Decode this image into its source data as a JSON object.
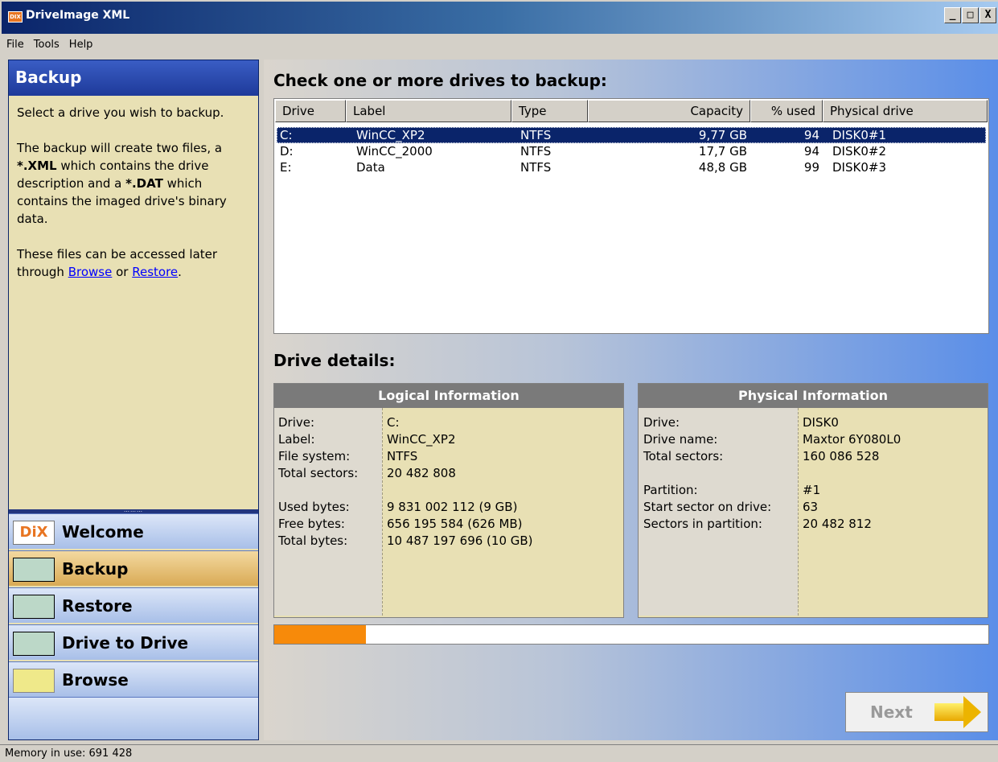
{
  "window": {
    "title": "DriveImage XML",
    "icon_text": "DIX",
    "minimize": "_",
    "maximize": "□",
    "close": "X"
  },
  "menu": {
    "file": "File",
    "tools": "Tools",
    "help": "Help"
  },
  "left_panel": {
    "header": "Backup",
    "p1": "Select a drive you wish to backup.",
    "p2_a": "The backup will create two files, a ",
    "p2_xml": "*.XML",
    "p2_b": " which contains the drive description and a ",
    "p2_dat": "*.DAT",
    "p2_c": " which contains the imaged drive's binary data.",
    "p3_a": "These files can be accessed later through ",
    "p3_browse": "Browse",
    "p3_or": " or ",
    "p3_restore": "Restore",
    "p3_end": ".",
    "divider": "………"
  },
  "nav": {
    "welcome": "Welcome",
    "welcome_icon": "DiX",
    "backup": "Backup",
    "restore": "Restore",
    "drive_to_drive": "Drive to Drive",
    "browse": "Browse"
  },
  "main": {
    "heading": "Check one or more drives to backup:",
    "details_heading": "Drive details:"
  },
  "drive_list": {
    "columns": [
      "Drive",
      "Label",
      "Type",
      "Capacity",
      "% used",
      "Physical drive"
    ],
    "rows": [
      {
        "drive": "C:",
        "label": "WinCC_XP2",
        "type": "NTFS",
        "capacity": "9,77 GB",
        "used": "94",
        "physical": "DISK0#1"
      },
      {
        "drive": "D:",
        "label": "WinCC_2000",
        "type": "NTFS",
        "capacity": "17,7 GB",
        "used": "94",
        "physical": "DISK0#2"
      },
      {
        "drive": "E:",
        "label": "Data",
        "type": "NTFS",
        "capacity": "48,8 GB",
        "used": "99",
        "physical": "DISK0#3"
      }
    ]
  },
  "logical": {
    "header": "Logical Information",
    "labels": [
      "Drive:",
      "Label:",
      "File system:",
      "Total sectors:",
      "Used bytes:",
      "Free bytes:",
      "Total bytes:"
    ],
    "values": [
      "C:",
      "WinCC_XP2",
      "NTFS",
      "20 482 808",
      "9 831 002 112 (9 GB)",
      "656 195 584 (626 MB)",
      "10 487 197 696 (10 GB)"
    ]
  },
  "physical": {
    "header": "Physical Information",
    "labels": [
      "Drive:",
      "Drive name:",
      "Total sectors:",
      "Partition:",
      "Start sector on drive:",
      "Sectors in partition:"
    ],
    "values": [
      "DISK0",
      "Maxtor 6Y080L0",
      "160 086 528",
      "#1",
      "63",
      "20 482 812"
    ]
  },
  "progress": {
    "value": 0.128
  },
  "next_button": {
    "label": "Next"
  },
  "status": {
    "memory": "Memory in use: 691 428"
  },
  "colors": {
    "title_bar": "#0a246a",
    "selection": "#0a246a",
    "progress": "#f78a0a",
    "panel_bg": "#e8e0b4",
    "active_nav": "#d9aa55"
  }
}
